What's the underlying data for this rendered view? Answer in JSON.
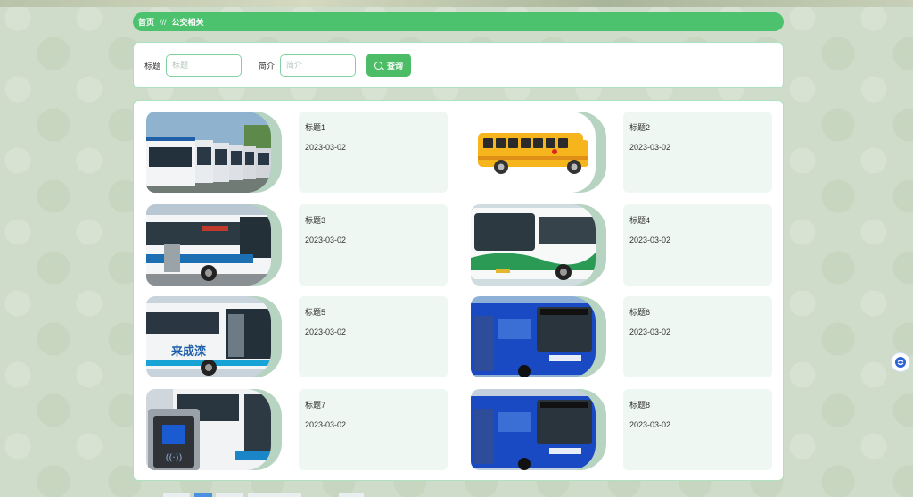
{
  "breadcrumb": {
    "home": "首页",
    "separator": "///",
    "current": "公交相关"
  },
  "search": {
    "title_label": "标题",
    "title_placeholder": "标题",
    "intro_label": "简介",
    "intro_placeholder": "简介",
    "query_button": "查询"
  },
  "cards": [
    {
      "title": "标题1",
      "date": "2023-03-02",
      "image": "bus-fleet-photo"
    },
    {
      "title": "标题2",
      "date": "2023-03-02",
      "image": "school-bus-illustration"
    },
    {
      "title": "标题3",
      "date": "2023-03-02",
      "image": "white-blue-bus-photo"
    },
    {
      "title": "标题4",
      "date": "2023-03-02",
      "image": "green-white-bus-photo"
    },
    {
      "title": "标题5",
      "date": "2023-03-02",
      "image": "city-bus-photo"
    },
    {
      "title": "标题6",
      "date": "2023-03-02",
      "image": "blue-bus-photo"
    },
    {
      "title": "标题7",
      "date": "2023-03-02",
      "image": "bus-card-reader-photo"
    },
    {
      "title": "标题8",
      "date": "2023-03-02",
      "image": "blue-bus-photo"
    }
  ],
  "colors": {
    "accent": "#4cc26e",
    "button": "#4cbd66",
    "panel_border": "#aee0c2",
    "info_bg": "#eef7f1"
  }
}
